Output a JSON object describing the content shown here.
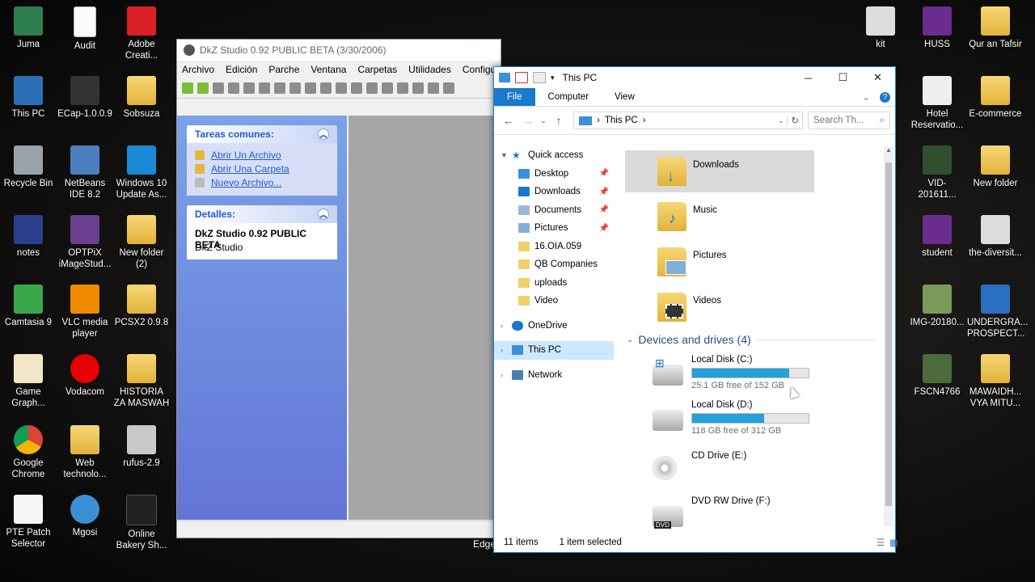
{
  "desktop": {
    "icons": [
      {
        "label": "Juma"
      },
      {
        "label": "Audit"
      },
      {
        "label": "Adobe Creati..."
      },
      {
        "label": "This PC"
      },
      {
        "label": "ECap-1.0.0.9"
      },
      {
        "label": "Sobsuza"
      },
      {
        "label": "Recycle Bin"
      },
      {
        "label": "NetBeans IDE 8.2"
      },
      {
        "label": "Windows 10 Update As..."
      },
      {
        "label": "notes"
      },
      {
        "label": "OPTPiX iMageStud..."
      },
      {
        "label": "New folder (2)"
      },
      {
        "label": "Camtasia 9"
      },
      {
        "label": "VLC media player"
      },
      {
        "label": "PCSX2 0.9.8"
      },
      {
        "label": "Game Graph..."
      },
      {
        "label": "Vodacom"
      },
      {
        "label": "HISTORIA ZA MASWAH"
      },
      {
        "label": "Google Chrome"
      },
      {
        "label": "Web technolo..."
      },
      {
        "label": "rufus-2.9"
      },
      {
        "label": "PTE Patch Selector"
      },
      {
        "label": "Mgosi"
      },
      {
        "label": "Online Bakery Sh..."
      },
      {
        "label": "kit"
      },
      {
        "label": "HUSS"
      },
      {
        "label": "Qur an Tafsir"
      },
      {
        "label": "Hotel Reservatio..."
      },
      {
        "label": "E-commerce"
      },
      {
        "label": "VID-201611..."
      },
      {
        "label": "New folder"
      },
      {
        "label": "student"
      },
      {
        "label": "the-diversit..."
      },
      {
        "label": "IMG-20180..."
      },
      {
        "label": "UNDERGRA... PROSPECT..."
      },
      {
        "label": "FSCN4766"
      },
      {
        "label": "MAWAIDH... VYA MITU..."
      }
    ],
    "edge_label": "Edge"
  },
  "dkz": {
    "title": "DkZ Studio 0.92 PUBLIC BETA (3/30/2006)",
    "menu": [
      "Archivo",
      "Edición",
      "Parche",
      "Ventana",
      "Carpetas",
      "Utilidades",
      "Configur"
    ],
    "tareas": {
      "header": "Tareas comunes:",
      "links": [
        "Abrir Un Archivo",
        "Abrir Una Carpeta",
        "Nuevo Archivo..."
      ]
    },
    "detalles": {
      "header": "Detalles:",
      "name": "DkZ Studio 0.92 PUBLIC BETA",
      "sub": "DkZ Studio"
    }
  },
  "explorer": {
    "title": "This PC",
    "ribbon_tabs": [
      "File",
      "Computer",
      "View"
    ],
    "address": "This PC",
    "search_placeholder": "Search Th...",
    "nav": {
      "quick_access": "Quick access",
      "items": [
        "Desktop",
        "Downloads",
        "Documents",
        "Pictures",
        "16.OIA.059",
        "QB Companies",
        "uploads",
        "Video"
      ],
      "onedrive": "OneDrive",
      "this_pc": "This PC",
      "network": "Network"
    },
    "folders": [
      "Downloads",
      "Music",
      "Pictures",
      "Videos"
    ],
    "devices_header": "Devices and drives (4)",
    "drives": [
      {
        "name": "Local Disk (C:)",
        "free": "25.1 GB free of 152 GB",
        "used_fraction": 0.835
      },
      {
        "name": "Local Disk (D:)",
        "free": "118 GB free of 312 GB",
        "used_fraction": 0.62
      },
      {
        "name": "CD Drive (E:)"
      },
      {
        "name": "DVD RW Drive (F:)"
      }
    ],
    "status": {
      "items": "11 items",
      "selected": "1 item selected"
    }
  }
}
